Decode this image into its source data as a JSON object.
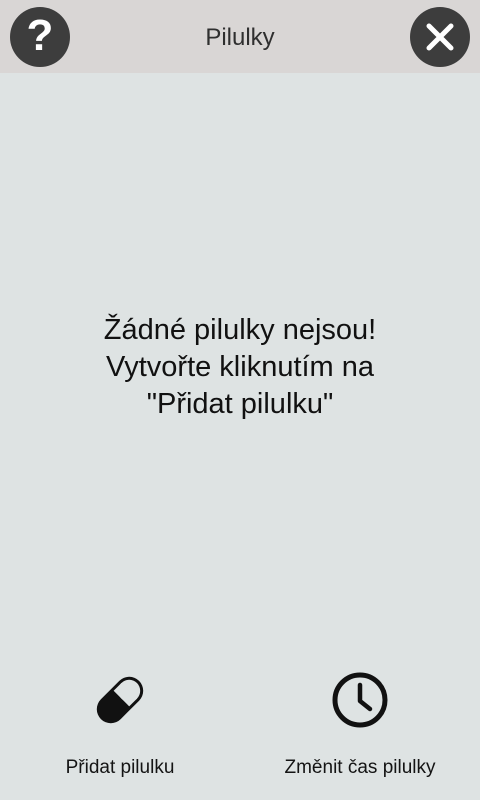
{
  "header": {
    "title": "Pilulky",
    "help_icon": "question-mark-icon",
    "close_icon": "close-x-icon"
  },
  "empty_state": {
    "line1": "Žádné pilulky nejsou!",
    "line2": "Vytvořte kliknutím na",
    "line3": "\"Přidat pilulku\""
  },
  "actions": {
    "add_pill": {
      "label": "Přidat pilulku",
      "icon": "pill-icon"
    },
    "change_time": {
      "label": "Změnit čas pilulky",
      "icon": "clock-icon"
    }
  },
  "colors": {
    "background": "#dee3e3",
    "header": "#d9d6d5",
    "button": "#3d3d3d"
  }
}
